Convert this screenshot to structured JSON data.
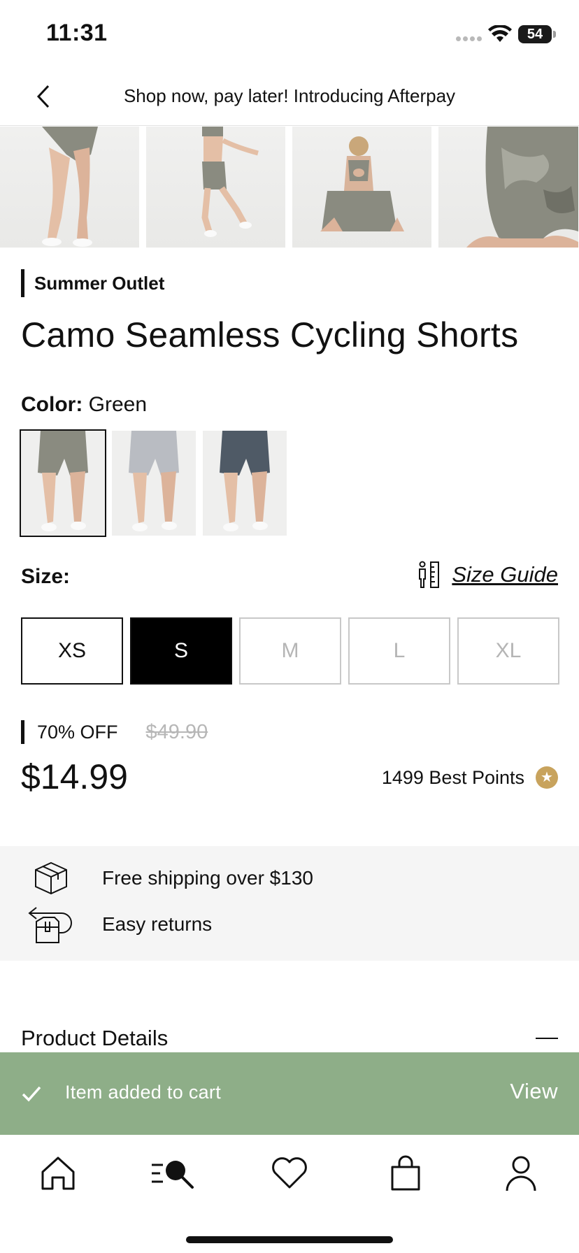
{
  "status_bar": {
    "time": "11:31",
    "battery": "54"
  },
  "top_nav": {
    "promo_text": "Shop now, pay later! Introducing Afterpay"
  },
  "gallery": [
    {
      "icon": "product-photo-legs"
    },
    {
      "icon": "product-photo-jumping"
    },
    {
      "icon": "product-photo-back"
    },
    {
      "icon": "product-photo-closeup"
    }
  ],
  "product": {
    "category": "Summer Outlet",
    "title": "Camo Seamless Cycling Shorts",
    "color_label": "Color:",
    "color_value": "Green",
    "swatches": [
      {
        "name": "Green",
        "selected": true,
        "tone": "#8a8b80"
      },
      {
        "name": "Light Grey",
        "selected": false,
        "tone": "#b9bcc2"
      },
      {
        "name": "Dark Blue",
        "selected": false,
        "tone": "#4f5a66"
      }
    ],
    "size_label": "Size:",
    "size_guide_label": "Size Guide",
    "sizes": [
      {
        "label": "XS",
        "state": "available"
      },
      {
        "label": "S",
        "state": "selected"
      },
      {
        "label": "M",
        "state": "disabled"
      },
      {
        "label": "L",
        "state": "disabled"
      },
      {
        "label": "XL",
        "state": "disabled"
      }
    ],
    "discount": "70% OFF",
    "old_price": "$49.90",
    "price": "$14.99",
    "points": "1499 Best Points"
  },
  "perks": [
    {
      "icon": "box-icon",
      "text": "Free shipping over $130"
    },
    {
      "icon": "return-box-icon",
      "text": "Easy returns"
    }
  ],
  "details": {
    "title": "Product Details"
  },
  "toast": {
    "message": "Item added to cart",
    "action": "View",
    "color": "#8eae88"
  },
  "tabbar": [
    {
      "icon": "home-icon"
    },
    {
      "icon": "search-menu-icon"
    },
    {
      "icon": "heart-icon"
    },
    {
      "icon": "bag-icon"
    },
    {
      "icon": "profile-icon"
    }
  ],
  "colors": {
    "accent": "#000000",
    "points": "#c8a35d"
  }
}
